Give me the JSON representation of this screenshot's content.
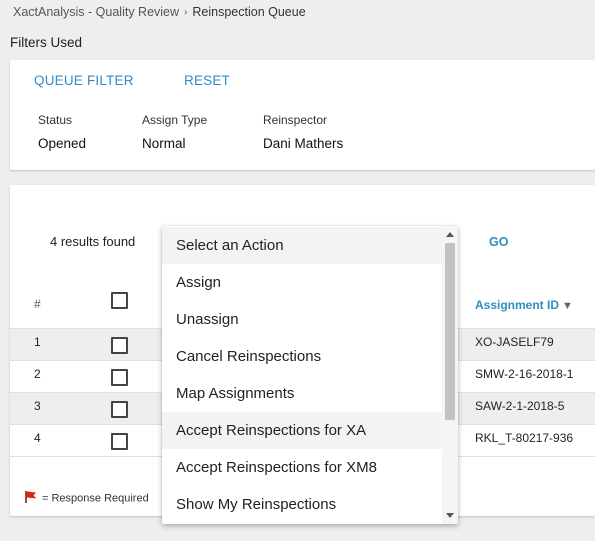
{
  "breadcrumb": {
    "root": "XactAnalysis - Quality Review",
    "separator": "›",
    "current": "Reinspection Queue"
  },
  "filters_label": "Filters Used",
  "filter_card": {
    "queue_filter": "QUEUE FILTER",
    "reset": "RESET",
    "fields": [
      {
        "label": "Status",
        "value": "Opened"
      },
      {
        "label": "Assign Type",
        "value": "Normal"
      },
      {
        "label": "Reinspector",
        "value": "Dani Mathers"
      }
    ]
  },
  "results": {
    "count_text": "4 results found",
    "go": "GO",
    "headers": {
      "num": "#",
      "assignment_id": "Assignment ID",
      "sort_icon": "▼"
    },
    "rows": [
      {
        "num": "1",
        "assignment_id": "XO-JASELF79"
      },
      {
        "num": "2",
        "assignment_id": "SMW-2-16-2018-1"
      },
      {
        "num": "3",
        "assignment_id": "SAW-2-1-2018-5"
      },
      {
        "num": "4",
        "assignment_id": "RKL_T-80217-936"
      }
    ],
    "legend": "=  Response Required"
  },
  "action_dropdown": {
    "items": [
      "Select an Action",
      "Assign",
      "Unassign",
      "Cancel Reinspections",
      "Map Assignments",
      "Accept Reinspections for XA",
      "Accept Reinspections for XM8",
      "Show My Reinspections"
    ]
  },
  "colors": {
    "accent": "#2f8ec1",
    "flag": "#e0201b",
    "row_alt": "#eeeeee",
    "background": "#eeeeee"
  },
  "icons": [
    "chevron-right-icon",
    "sort-down-icon",
    "flag-icon",
    "scroll-up-icon",
    "scroll-down-icon"
  ]
}
